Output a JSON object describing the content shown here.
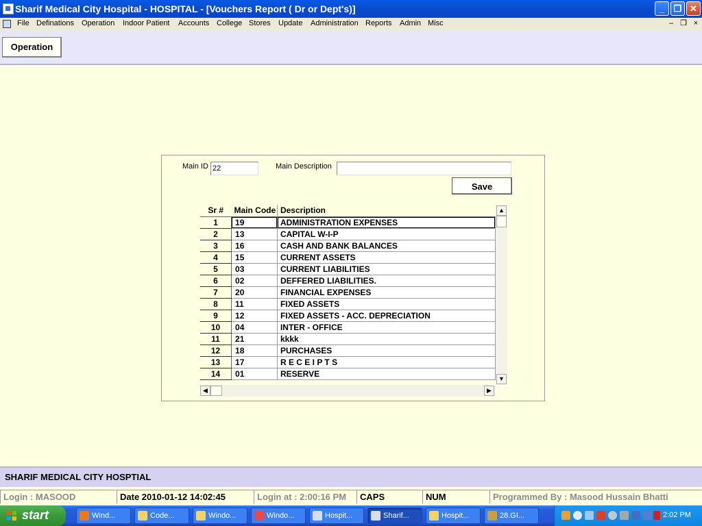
{
  "window": {
    "title": "Sharif Medical City Hospital - HOSPITAL - [Vouchers Report ( Dr or Dept's)]",
    "controls": {
      "minimize": "_",
      "restore": "❐",
      "close": "✕"
    }
  },
  "menu": {
    "items": [
      "File",
      "Definations",
      "Operation",
      "Indoor Patient",
      "Accounts",
      "College",
      "Stores",
      "Update",
      "Administration",
      "Reports",
      "Admin",
      "Misc"
    ],
    "mdi_controls": {
      "minimize": "–",
      "restore": "❐",
      "close": "×"
    }
  },
  "toolbar": {
    "operation_label": "Operation"
  },
  "form": {
    "main_id_label": "Main ID",
    "main_id_value": "22",
    "main_description_label": "Main Description",
    "main_description_value": "",
    "save_label": "Save"
  },
  "grid": {
    "headers": {
      "sr": "Sr #",
      "code": "Main Code",
      "desc": "Description"
    },
    "rows": [
      {
        "sr": "1",
        "code": "19",
        "desc": "ADMINISTRATION EXPENSES"
      },
      {
        "sr": "2",
        "code": "13",
        "desc": "CAPITAL W-I-P"
      },
      {
        "sr": "3",
        "code": "16",
        "desc": "CASH AND BANK BALANCES"
      },
      {
        "sr": "4",
        "code": "15",
        "desc": "CURRENT ASSETS"
      },
      {
        "sr": "5",
        "code": "03",
        "desc": "CURRENT LIABILITIES"
      },
      {
        "sr": "6",
        "code": "02",
        "desc": "DEFFERED LIABILITIES."
      },
      {
        "sr": "7",
        "code": "20",
        "desc": "FINANCIAL EXPENSES"
      },
      {
        "sr": "8",
        "code": "11",
        "desc": "FIXED ASSETS"
      },
      {
        "sr": "9",
        "code": "12",
        "desc": "FIXED ASSETS - ACC. DEPRECIATION"
      },
      {
        "sr": "10",
        "code": "04",
        "desc": "INTER - OFFICE"
      },
      {
        "sr": "11",
        "code": "21",
        "desc": "kkkk"
      },
      {
        "sr": "12",
        "code": "18",
        "desc": "PURCHASES"
      },
      {
        "sr": "13",
        "code": "17",
        "desc": "R E C E I P T S"
      },
      {
        "sr": "14",
        "code": "01",
        "desc": "RESERVE"
      }
    ],
    "scroll_arrows": {
      "up": "▲",
      "down": "▼",
      "left": "◀",
      "right": "▶"
    }
  },
  "status": {
    "org_name": "SHARIF MEDICAL CITY HOSPTIAL",
    "login": "Login :  MASOOD",
    "date": "Date 2010-01-12 14:02:45",
    "login_at": "Login at : 2:00:16 PM",
    "caps": "CAPS",
    "num": "NUM",
    "programmed_by": "Programmed By : Masood Hussain Bhatti"
  },
  "taskbar": {
    "start_label": "start",
    "tasks": [
      "Wind...",
      "Code...",
      "Windo...",
      "Windo...",
      "Hospit...",
      "Sharif...",
      "Hospit...",
      "28.GI..."
    ],
    "clock": "2:02 PM"
  },
  "colors": {
    "form_background": "#FFFFE1",
    "toolbar_background": "#E7E7FA",
    "title_bar": "#0A5BE8",
    "taskbar": "#245DDB",
    "start_button": "#3A9A3A"
  }
}
